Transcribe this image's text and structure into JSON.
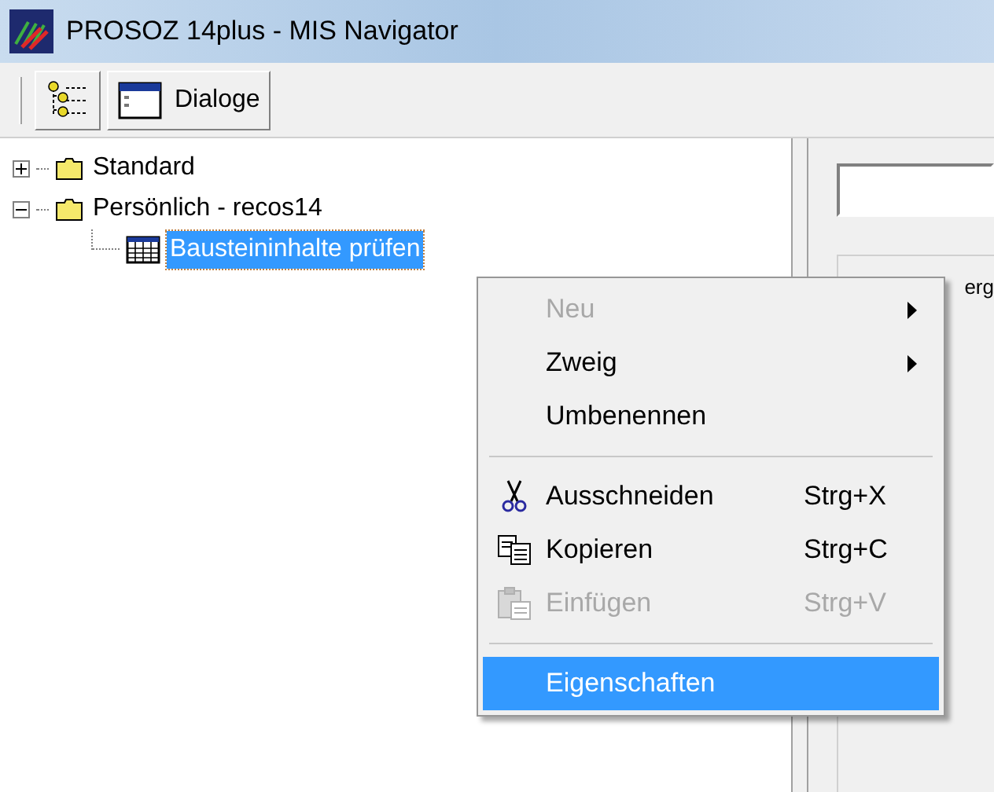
{
  "window": {
    "title": "PROSOZ 14plus - MIS Navigator"
  },
  "toolbar": {
    "buttons": [
      {
        "kind": "tree"
      },
      {
        "kind": "dialog",
        "label": "Dialoge"
      }
    ]
  },
  "tree": [
    {
      "label": "Standard",
      "kind": "folder",
      "expanded": false,
      "selected": false
    },
    {
      "label": "Persönlich - recos14",
      "kind": "folder",
      "expanded": true,
      "selected": false,
      "children": [
        {
          "label": "Bausteininhalte prüfen",
          "kind": "table",
          "selected": true
        }
      ]
    }
  ],
  "right_panel": {
    "group_text": "erg"
  },
  "context_menu": [
    {
      "kind": "item",
      "label": "Neu",
      "disabled": true,
      "submenu": true,
      "selected": false
    },
    {
      "kind": "item",
      "label": "Zweig",
      "disabled": false,
      "submenu": true,
      "selected": false
    },
    {
      "kind": "item",
      "label": "Umbenennen",
      "disabled": false,
      "submenu": false,
      "selected": false
    },
    {
      "kind": "separator"
    },
    {
      "kind": "cut",
      "label": "Ausschneiden",
      "shortcut": "Strg+X",
      "disabled": false,
      "submenu": false,
      "selected": false
    },
    {
      "kind": "copy",
      "label": "Kopieren",
      "shortcut": "Strg+C",
      "disabled": false,
      "submenu": false,
      "selected": false
    },
    {
      "kind": "paste",
      "label": "Einfügen",
      "shortcut": "Strg+V",
      "disabled": true,
      "submenu": false,
      "selected": false
    },
    {
      "kind": "separator"
    },
    {
      "kind": "item",
      "label": "Eigenschaften",
      "disabled": false,
      "submenu": false,
      "selected": true
    }
  ]
}
